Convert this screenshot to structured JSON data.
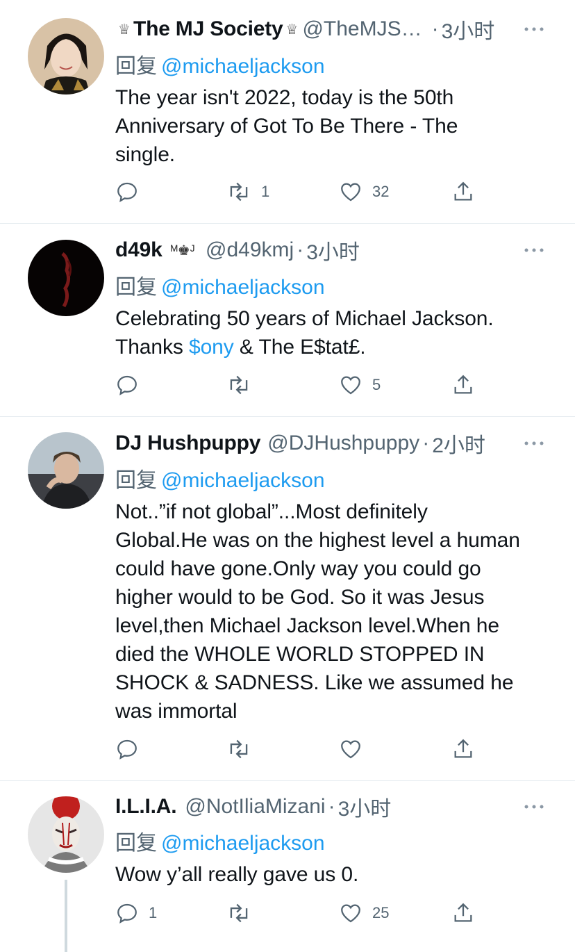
{
  "tweets": [
    {
      "name": "The MJ Society",
      "badge_left": "♕",
      "badge_right": "♕",
      "handle": "@TheMJS…",
      "dot": "·",
      "time": "3小时",
      "reply_prefix": "回复",
      "reply_to": "@michaeljackson",
      "text_lines": [
        "The year isn't 2022, today is the 50th",
        "Anniversary of Got To Be There - The",
        "single."
      ],
      "counts": {
        "reply": "",
        "retweet": "1",
        "like": "32"
      }
    },
    {
      "name": "d49k",
      "badge_left": "",
      "badge_right": "ᴹ♚ᴶ",
      "handle": "@d49kmj",
      "dot": "·",
      "time": "3小时",
      "reply_prefix": "回复",
      "reply_to": "@michaeljackson",
      "text_line1": "Celebrating 50 years of Michael Jackson.",
      "text_line2_pre": "Thanks ",
      "cashtag": "$ony",
      "text_line2_post": " & The E$tat£.",
      "counts": {
        "reply": "",
        "retweet": "",
        "like": "5"
      }
    },
    {
      "name": "DJ Hushpuppy",
      "handle": "@DJHushpuppy",
      "dot": "·",
      "time": "2小时",
      "reply_prefix": "回复",
      "reply_to": "@michaeljackson",
      "text_lines": [
        "Not..”if not global”...Most definitely",
        "Global.He was on the highest level a human",
        "could have gone.Only way you could go",
        "higher would to be God. So it was Jesus",
        "level,then Michael Jackson level.When he",
        "died the WHOLE WORLD STOPPED IN",
        "SHOCK & SADNESS. Like we assumed he",
        "was immortal"
      ],
      "counts": {
        "reply": "",
        "retweet": "",
        "like": ""
      }
    },
    {
      "name": "I.L.I.A.",
      "handle": "@NotIliaMizani",
      "dot": "·",
      "time": "3小时",
      "reply_prefix": "回复",
      "reply_to": "@michaeljackson",
      "text_lines": [
        "Wow y’all really gave us 0."
      ],
      "counts": {
        "reply": "1",
        "retweet": "",
        "like": "25"
      }
    }
  ],
  "more_icon": "more-horizontal-icon",
  "colors": {
    "link": "#1d9bf0",
    "secondary": "#536471",
    "divider": "#e6ecf0",
    "text": "#0f1419"
  }
}
